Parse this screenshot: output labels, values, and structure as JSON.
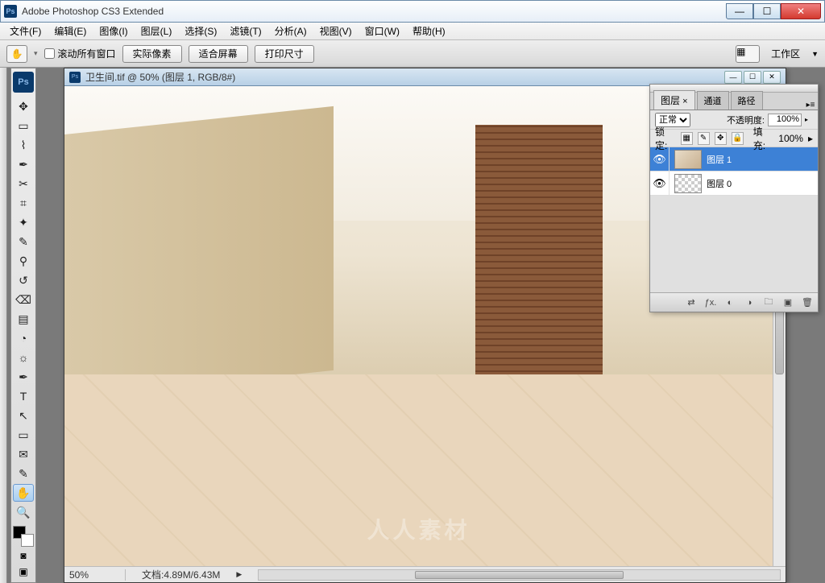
{
  "titlebar": {
    "app_icon_text": "Ps",
    "title": "Adobe Photoshop CS3 Extended"
  },
  "menu": {
    "file": "文件(F)",
    "edit": "编辑(E)",
    "image": "图像(I)",
    "layer": "图层(L)",
    "select": "选择(S)",
    "filter": "滤镜(T)",
    "analysis": "分析(A)",
    "view": "视图(V)",
    "window": "窗口(W)",
    "help": "帮助(H)"
  },
  "options": {
    "scroll_all_windows": "滚动所有窗口",
    "actual_pixels": "实际像素",
    "fit_screen": "适合屏幕",
    "print_size": "打印尺寸",
    "workspace": "工作区"
  },
  "document": {
    "title": "卫生间.tif @ 50% (图层 1, RGB/8#)",
    "zoom": "50%",
    "docinfo": "文档:4.89M/6.43M"
  },
  "layers_panel": {
    "tabs": {
      "layers": "图层",
      "channels": "通道",
      "paths": "路径"
    },
    "blend_mode": "正常",
    "opacity_label": "不透明度:",
    "opacity_value": "100%",
    "lock_label": "锁定:",
    "fill_label": "填充:",
    "fill_value": "100%",
    "layers": [
      {
        "name": "图层 1",
        "visible": true,
        "selected": true,
        "checker": false
      },
      {
        "name": "图层 0",
        "visible": true,
        "selected": false,
        "checker": true
      }
    ]
  },
  "watermark": "人人素材"
}
